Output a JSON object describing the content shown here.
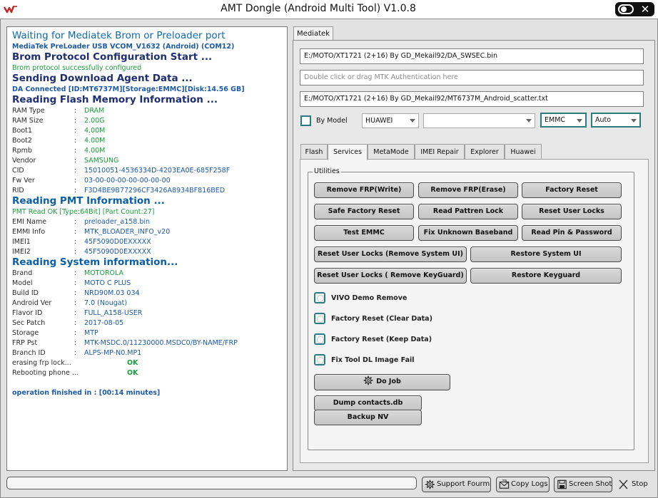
{
  "window": {
    "title": "AMT Dongle (Android Multi Tool) V1.0.8",
    "close_glyph": "✕"
  },
  "log": {
    "waiting": "Waiting for Mediatek Brom or Preloader port",
    "port": "MediaTek PreLoader USB VCOM_V1632 (Android) (COM12)",
    "brom_head": "Brom Protocol Configuration Start ...",
    "brom_ok": "Brom protocol successfully configured",
    "da_head": "Sending Download Agent Data ...",
    "da_info": "DA Connected [ID:MT6737M][Storage:EMMC][Disk:14.56 GB]",
    "flash_head": "Reading Flash Memory Information ...",
    "flash_rows": [
      {
        "key": "RAM Type",
        "val": "DRAM",
        "color": "green"
      },
      {
        "key": "RAM Size",
        "val": "2.00G",
        "color": "green"
      },
      {
        "key": "Boot1",
        "val": "4.00M",
        "color": "green"
      },
      {
        "key": "Boot2",
        "val": "4.00M",
        "color": "green"
      },
      {
        "key": "Rpmb",
        "val": "4.00M",
        "color": "green"
      },
      {
        "key": "Vendor",
        "val": "SAMSUNG",
        "color": "green"
      },
      {
        "key": "CID",
        "val": "15010051-4536334D-4203EA0E-685F258F",
        "color": "blue"
      },
      {
        "key": "Fw Ver",
        "val": "03-00-00-00-00-00-00-00",
        "color": "blue"
      },
      {
        "key": "RID",
        "val": "F3D4BE9B77296CF3426A8934BF816BED",
        "color": "blue"
      }
    ],
    "pmt_head": "Reading PMT Information ...",
    "pmt_ok": "PMT Read OK [Type:64Bit] [Part Count:27]",
    "pmt_rows": [
      {
        "key": "EMI Name",
        "val": "preloader_a158.bin",
        "color": "blue"
      },
      {
        "key": "EMMI Info",
        "val": "MTK_BLOADER_INFO_v20",
        "color": "blue"
      },
      {
        "key": "IMEI1",
        "val": "45F5090D0EXXXXX",
        "color": "blue"
      },
      {
        "key": "IMEI2",
        "val": "45F5090D0EXXXXX",
        "color": "blue"
      }
    ],
    "sys_head": "Reading System information...",
    "sys_rows": [
      {
        "key": "Brand",
        "val": "MOTOROLA",
        "color": "green"
      },
      {
        "key": "Model",
        "val": "MOTO C PLUS",
        "color": "blue"
      },
      {
        "key": "Build ID",
        "val": "NRD90M.03 034",
        "color": "blue"
      },
      {
        "key": "Android Ver",
        "val": "7.0 (Nougat)",
        "color": "blue"
      },
      {
        "key": "Flavor ID",
        "val": "FULL_A158-USER",
        "color": "blue"
      },
      {
        "key": "Sec Patch",
        "val": "2017-08-05",
        "color": "blue"
      },
      {
        "key": "Storage",
        "val": "MTP",
        "color": "blue"
      },
      {
        "key": "FRP Pst",
        "val": "MTK-MSDC.0/11230000.MSDC0/BY-NAME/FRP",
        "color": "blue"
      },
      {
        "key": "Branch ID",
        "val": "ALPS-MP-N0.MP1",
        "color": "blue"
      }
    ],
    "erasing_key": "erasing frp lock...",
    "erasing_val": "OK",
    "reboot_key": "Rebooting phone ...",
    "reboot_val": "OK",
    "finished": "operation finished in : [00:14 minutes]",
    "colon": ":"
  },
  "right": {
    "main_tab": "Mediatek",
    "da_path": "E:/MOTO/XT1721 (2+16) By GD_Mekail92/DA_SWSEC.bin",
    "auth_placeholder": "Double click or drag MTK Authentication here",
    "scatter_path": "E:/MOTO/XT1721 (2+16) By GD_Mekail92/MT6737M_Android_scatter.txt",
    "by_model_label": "By Model",
    "brand_combo": "HUAWEI",
    "model_combo": "",
    "storage_combo": "EMMC",
    "mode_combo": "Auto",
    "subtabs": [
      "Flash",
      "Services",
      "MetaMode",
      "IMEI Repair",
      "Explorer",
      "Huawei"
    ],
    "utilities_title": "Utilities",
    "buttons": {
      "remove_frp_write": "Remove FRP(Write)",
      "remove_frp_erase": "Remove FRP(Erase)",
      "factory_reset": "Factory Reset",
      "safe_factory_reset": "Safe Factory Reset",
      "read_pattern_lock": "Read Pattren Lock",
      "reset_user_locks": "Reset User Locks",
      "test_emmc": "Test EMMC",
      "fix_unknown_baseband": "Fix Unknown Baseband",
      "read_pin_password": "Read Pin & Password",
      "reset_user_locks_system_ui": "Reset User Locks (Remove System UI)",
      "restore_system_ui": "Restore System UI",
      "reset_user_locks_keyguard": "Reset User Locks ( Remove KeyGuard)",
      "restore_keyguard": "Restore Keyguard",
      "do_job": "Do Job",
      "dump_contacts": "Dump contacts.db",
      "backup_nv": "Backup NV"
    },
    "options": {
      "vivo_demo": "VIVO Demo Remove",
      "factory_reset_clear": "Factory Reset (Clear Data)",
      "factory_reset_keep": "Factory Reset (Keep Data)",
      "fix_tool_dl": "Fix Tool DL Image Fail"
    }
  },
  "bottom": {
    "support_forum": "Support Fourm",
    "copy_logs": "Copy Logs",
    "screen_shot": "Screen Shot",
    "stop": "Stop"
  }
}
